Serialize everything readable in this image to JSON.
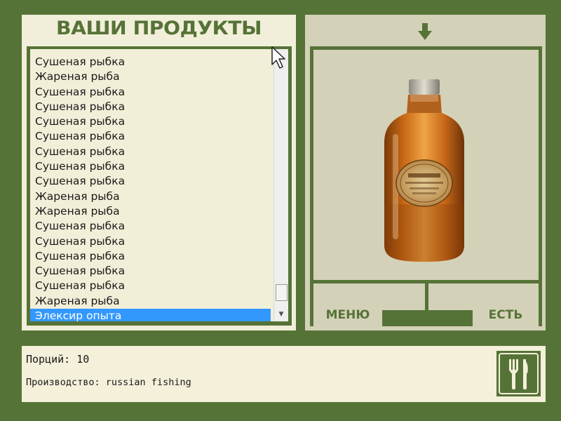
{
  "panel": {
    "title": "ВАШИ ПРОДУКТЫ"
  },
  "product_list": {
    "items": [
      "Сушеная рыбка",
      "Жареная рыба",
      "Сушеная рыбка",
      "Сушеная рыбка",
      "Сушеная рыбка",
      "Сушеная рыбка",
      "Сушеная рыбка",
      "Сушеная рыбка",
      "Сушеная рыбка",
      "Жареная рыба",
      "Жареная рыба",
      "Сушеная рыбка",
      "Сушеная рыбка",
      "Сушеная рыбка",
      "Сушеная рыбка",
      "Сушеная рыбка",
      "Жареная рыба",
      "Элексир опыта"
    ],
    "selected_index": 17
  },
  "preview": {
    "arrow_icon": "down-arrow-icon",
    "image_icon": "bottle-image"
  },
  "buttons": {
    "menu_label": "МЕНЮ",
    "eat_label": "ЕСТЬ"
  },
  "info": {
    "portions": "Порций: 10",
    "producer": "Производство: russian fishing"
  },
  "colors": {
    "background": "#567337",
    "panel_light": "#f1efd9",
    "panel_tan": "#d4d1b9",
    "selection": "#3398fe"
  },
  "icons": {
    "eat": "fork-knife-icon",
    "cursor": "mouse-pointer-icon"
  }
}
